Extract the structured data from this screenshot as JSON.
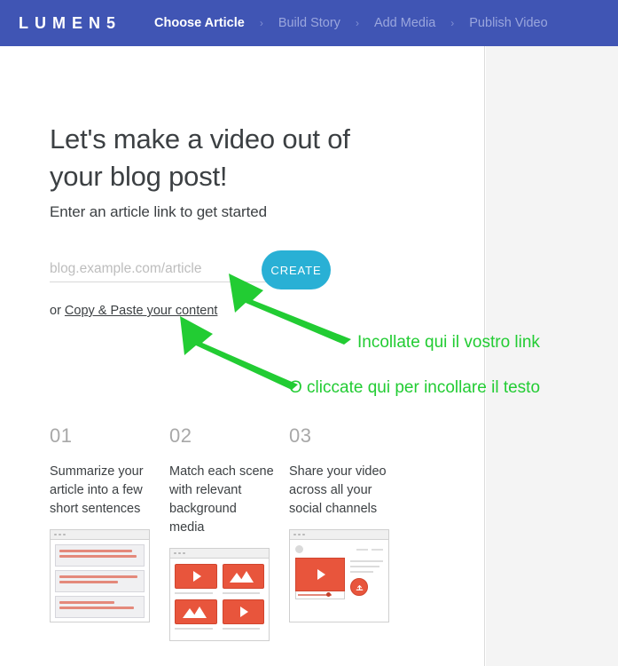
{
  "navbar": {
    "logo": "LUMEN5",
    "separator": "›",
    "steps": [
      {
        "label": "Choose Article",
        "active": true
      },
      {
        "label": "Build Story",
        "active": false
      },
      {
        "label": "Add Media",
        "active": false
      },
      {
        "label": "Publish Video",
        "active": false
      }
    ],
    "background_color": "#4055b4"
  },
  "hero": {
    "headline": "Let's make a video out of your blog post!",
    "subhead": "Enter an article link to get started",
    "url_placeholder": "blog.example.com/article",
    "url_value": "",
    "create_label": "CREATE",
    "create_color": "#29b0d5",
    "or_prefix": "or ",
    "or_link": "Copy & Paste your content"
  },
  "annotations": {
    "color": "#22cc33",
    "items": [
      {
        "text": "Incollate qui il vostro link"
      },
      {
        "text": "O cliccate qui per incollare il testo"
      }
    ]
  },
  "steps_section": {
    "cards": [
      {
        "number": "01",
        "text": "Summarize your article into a few short sentences",
        "icon": "article-list-icon"
      },
      {
        "number": "02",
        "text": "Match each scene with relevant background media",
        "icon": "media-grid-icon"
      },
      {
        "number": "03",
        "text": "Share your video across all your social channels",
        "icon": "video-share-icon"
      }
    ]
  }
}
